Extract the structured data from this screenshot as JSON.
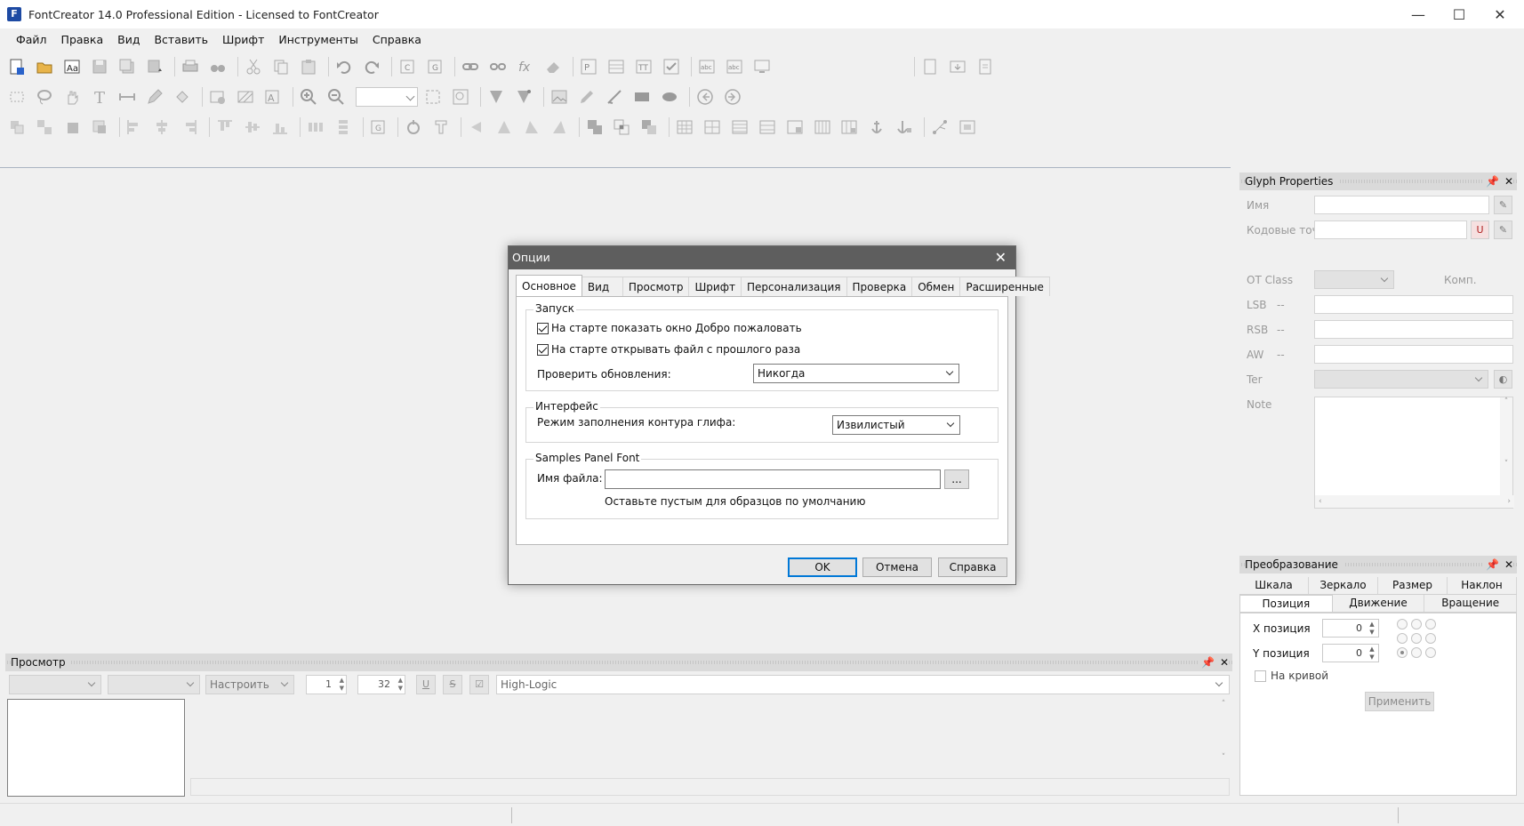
{
  "window": {
    "title": "FontCreator 14.0 Professional Edition - Licensed to FontCreator",
    "minimize": "—",
    "maximize": "☐",
    "close": "✕"
  },
  "menu": [
    "Файл",
    "Правка",
    "Вид",
    "Вставить",
    "Шрифт",
    "Инструменты",
    "Справка"
  ],
  "glyph_properties": {
    "title": "Glyph Properties",
    "name_label": "Имя",
    "codepoints_label": "Кодовые точк",
    "otclass_label": "OT Class",
    "comp_label": "Комп.",
    "lsb_label": "LSB",
    "rsb_label": "RSB",
    "aw_label": "AW",
    "tag_label": "Ter",
    "note_label": "Note",
    "dash": "--"
  },
  "transform": {
    "title": "Преобразование",
    "tabs_row1": [
      "Шкала",
      "Зеркало",
      "Размер",
      "Наклон"
    ],
    "tabs_row2": [
      "Позиция",
      "Движение",
      "Вращение"
    ],
    "x_label": "X позиция",
    "y_label": "Y позиция",
    "x_value": "0",
    "y_value": "0",
    "on_curve_label": "На кривой",
    "apply_label": "Применить"
  },
  "preview": {
    "title": "Просмотр",
    "customize": "Настроить",
    "spin1": "1",
    "spin2": "32",
    "sample_text": "High-Logic"
  },
  "dialog": {
    "title": "Опции",
    "tabs": [
      "Основное",
      "Вид",
      "Просмотр",
      "Шрифт",
      "Персонализация",
      "Проверка",
      "Обмен",
      "Расширенные"
    ],
    "startup": {
      "title": "Запуск",
      "show_welcome": "На старте показать окно Добро пожаловать",
      "open_last": "На старте открывать файл с прошлого раза",
      "check_updates_label": "Проверить обновления:",
      "check_updates_value": "Никогда"
    },
    "interface": {
      "title": "Интерфейс",
      "fill_mode_label": "Режим заполнения контура глифа:",
      "fill_mode_value": "Извилистый"
    },
    "samples": {
      "title": "Samples Panel Font",
      "filename_label": "Имя файла:",
      "browse": "...",
      "hint": "Оставьте пустым для образцов по умолчанию"
    },
    "ok": "OK",
    "cancel": "Отмена",
    "help": "Справка"
  }
}
